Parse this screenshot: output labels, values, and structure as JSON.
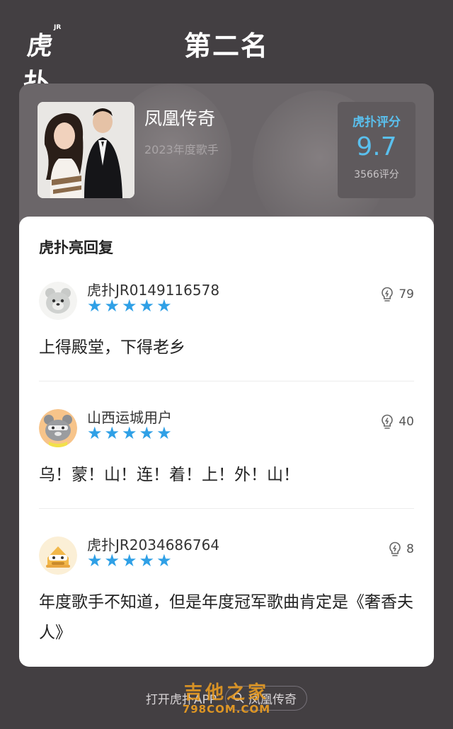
{
  "header": {
    "logo_text": "虎扑",
    "logo_jr": "JR",
    "title": "第二名"
  },
  "artist": {
    "name": "凤凰传奇",
    "subtitle": "2023年度歌手",
    "score_label": "虎扑评分",
    "score": "9.7",
    "score_count": "3566评分"
  },
  "replies_section": {
    "title": "虎扑亮回复",
    "items": [
      {
        "username": "虎扑JR0149116578",
        "rating": 5,
        "likes": "79",
        "content": "上得殿堂，下得老乡",
        "avatar": "gray-bear-avatar-icon"
      },
      {
        "username": "山西运城用户",
        "rating": 5,
        "likes": "40",
        "content": "乌！蒙！山！连！着！上！外！山！",
        "avatar": "orange-bear-avatar-icon"
      },
      {
        "username": "虎扑JR2034686764",
        "rating": 5,
        "likes": "8",
        "content": "年度歌手不知道，但是年度冠军歌曲肯定是《奢香夫人》",
        "avatar": "yellow-bear-avatar-icon"
      }
    ]
  },
  "bottom_bar": {
    "open_app": "打开虎扑APP",
    "search_text": "凤凰传奇"
  },
  "watermark": {
    "cn": "吉他之家",
    "en": "798COM.COM"
  },
  "colors": {
    "background": "#433f42",
    "accent_blue": "#5ac0ee",
    "star_blue": "#2fa0e6",
    "watermark_orange": "#f0a020"
  }
}
